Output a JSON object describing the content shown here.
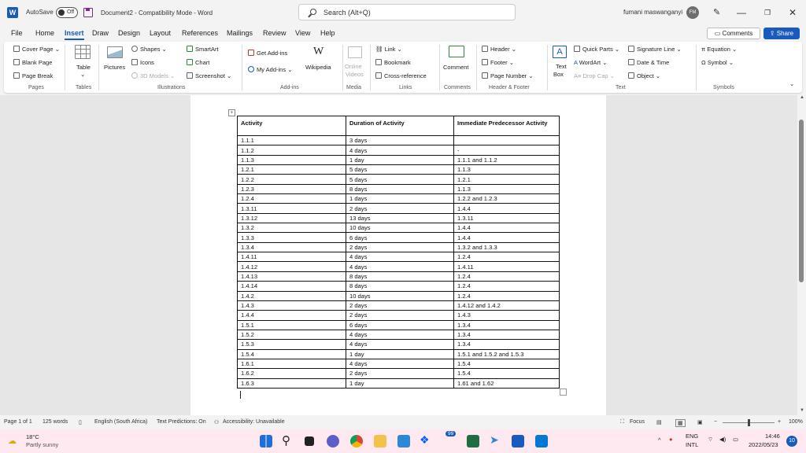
{
  "titlebar": {
    "app_letter": "W",
    "autosave_label": "AutoSave",
    "autosave_state": "Off",
    "document_title": "Document2 - Compatibility Mode - Word",
    "search_placeholder": "Search (Alt+Q)",
    "user_name": "fumani maswanganyi",
    "user_initials": "FM",
    "minimize": "—",
    "restore": "❐",
    "close": "✕"
  },
  "tabs": [
    "File",
    "Home",
    "Insert",
    "Draw",
    "Design",
    "Layout",
    "References",
    "Mailings",
    "Review",
    "View",
    "Help"
  ],
  "active_tab": "Insert",
  "buttons": {
    "comments": "Comments",
    "share": "Share"
  },
  "ribbon": {
    "pages": {
      "items": [
        "Cover Page",
        "Blank Page",
        "Page Break"
      ],
      "label": "Pages"
    },
    "tables": {
      "table": "Table",
      "label": "Tables"
    },
    "illustrations": {
      "pictures": "Pictures",
      "shapes": "Shapes",
      "icons": "Icons",
      "models": "3D Models",
      "smartart": "SmartArt",
      "chart": "Chart",
      "screenshot": "Screenshot",
      "label": "Illustrations"
    },
    "addins": {
      "get": "Get Add-ins",
      "my": "My Add-ins",
      "wikipedia": "Wikipedia",
      "label": "Add-ins"
    },
    "media": {
      "online_videos_1": "Online",
      "online_videos_2": "Videos",
      "label": "Media"
    },
    "links": {
      "link": "Link",
      "bookmark": "Bookmark",
      "cross": "Cross-reference",
      "label": "Links"
    },
    "comments": {
      "comment": "Comment",
      "label": "Comments"
    },
    "header_footer": {
      "header": "Header",
      "footer": "Footer",
      "page_number": "Page Number",
      "label": "Header & Footer"
    },
    "text": {
      "textbox_1": "Text",
      "textbox_2": "Box",
      "quick_parts": "Quick Parts",
      "wordart": "WordArt",
      "drop_cap": "Drop Cap",
      "signature": "Signature Line",
      "date_time": "Date & Time",
      "object": "Object",
      "label": "Text"
    },
    "symbols": {
      "equation": "Equation",
      "symbol": "Symbol",
      "label": "Symbols"
    }
  },
  "table": {
    "headers": [
      "Activity",
      "Duration of Activity",
      "Immediate Predecessor Activity"
    ],
    "rows": [
      [
        "1.1.1",
        "3 days",
        ""
      ],
      [
        "1.1.2",
        "4 days",
        "-"
      ],
      [
        "1.1.3",
        "1 day",
        "1.1.1 and 1.1.2"
      ],
      [
        "1.2.1",
        "5 days",
        "1.1.3"
      ],
      [
        "1.2.2",
        "5 days",
        "1.2.1"
      ],
      [
        "1.2.3",
        "8 days",
        "1.1.3"
      ],
      [
        "1.2.4",
        "1 days",
        "1.2.2 and 1.2.3"
      ],
      [
        "1.3.11",
        "2 days",
        "1.4.4"
      ],
      [
        "1.3.12",
        "13 days",
        "1.3.11"
      ],
      [
        "1.3.2",
        "10 days",
        "1.4.4"
      ],
      [
        "1.3.3",
        "6 days",
        "1.4.4"
      ],
      [
        "1.3.4",
        "2 days",
        "1.3.2 and 1.3.3"
      ],
      [
        "1.4.11",
        "4 days",
        "1.2.4"
      ],
      [
        "1.4.12",
        "4 days",
        "1.4.11"
      ],
      [
        "1.4.13",
        "8 days",
        "1.2.4"
      ],
      [
        "1.4.14",
        "8 days",
        "1.2.4"
      ],
      [
        "1.4.2",
        "10 days",
        "1.2.4"
      ],
      [
        "1.4.3",
        "2 days",
        "1.4.12 and 1.4.2"
      ],
      [
        "1.4.4",
        "2 days",
        "1.4.3"
      ],
      [
        "1.5.1",
        "6 days",
        "1.3.4"
      ],
      [
        "1.5.2",
        "4 days",
        "1.3.4"
      ],
      [
        "1.5.3",
        "4 days",
        "1.3.4"
      ],
      [
        "1.5.4",
        "1 day",
        "1.5.1 and 1.5.2 and 1.5.3"
      ],
      [
        "1.6.1",
        "4 days",
        "1.5.4"
      ],
      [
        "1.6.2",
        "2 days",
        "1.5.4"
      ],
      [
        "1.6.3",
        "1 day",
        "1.61 and 1.62"
      ]
    ]
  },
  "statusbar": {
    "page": "Page 1 of 1",
    "words": "125 words",
    "language": "English (South Africa)",
    "predictions": "Text Predictions: On",
    "accessibility": "Accessibility: Unavailable",
    "focus": "Focus",
    "zoom_minus": "−",
    "zoom_plus": "+",
    "zoom": "100%",
    "zoom_fraction": 0.5
  },
  "taskbar": {
    "temp": "18°C",
    "weather": "Partly sunny",
    "badge_count": "99",
    "lang_1": "ENG",
    "lang_2": "INTL",
    "time": "14:46",
    "date": "2022/05/23",
    "notifications": "10"
  },
  "colors": {
    "accent": "#185abd",
    "taskbar": "#fde9ef"
  }
}
